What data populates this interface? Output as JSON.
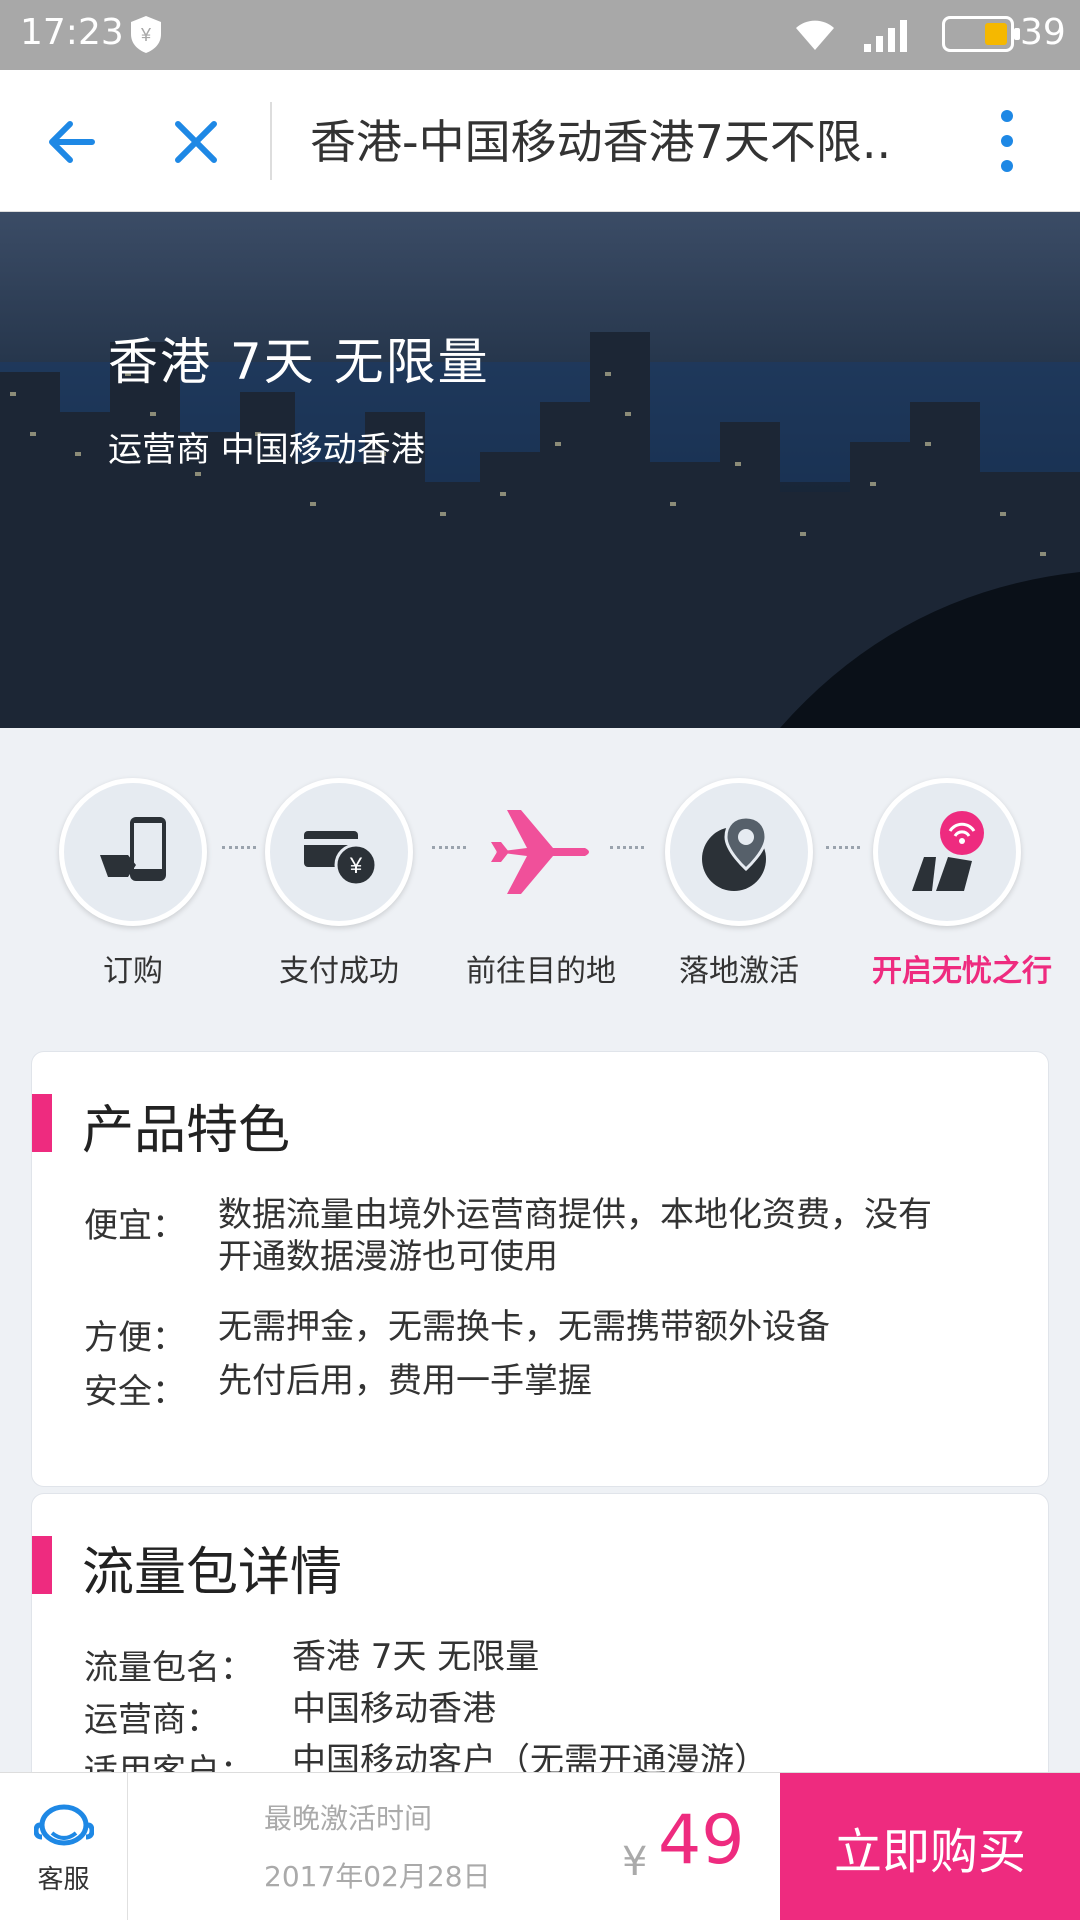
{
  "status_bar": {
    "time": "17:23",
    "battery": "39"
  },
  "nav": {
    "title": "香港-中国移动香港7天不限.."
  },
  "hero": {
    "title": "香港 7天  无限量",
    "subtitle": "运营商 中国移动香港"
  },
  "steps": [
    {
      "label": "订购",
      "icon": "phone-order-icon"
    },
    {
      "label": "支付成功",
      "icon": "payment-icon"
    },
    {
      "label": "前往目的地",
      "icon": "airplane-icon"
    },
    {
      "label": "落地激活",
      "icon": "location-pin-icon"
    },
    {
      "label": "开启无忧之行",
      "icon": "wifi-travel-icon",
      "highlight": true
    }
  ],
  "features": {
    "heading": "产品特色",
    "rows": [
      {
        "key": "便宜：",
        "value_line1": "数据流量由境外运营商提供，本地化资费，没有",
        "value_line2": "开通数据漫游也可使用"
      },
      {
        "key": "方便：",
        "value_line1": "无需押金，无需换卡，无需携带额外设备"
      },
      {
        "key": "安全：",
        "value_line1": "先付后用，费用一手掌握"
      }
    ]
  },
  "package": {
    "heading": "流量包详情",
    "rows": [
      {
        "key": "流量包名：",
        "value": "香港 7天 无限量"
      },
      {
        "key": "运营商：",
        "value": "中国移动香港"
      },
      {
        "key": "适用客户：",
        "value": "中国移动客户（无需开通漫游）"
      }
    ]
  },
  "bottom": {
    "service_label": "客服",
    "deadline_label": "最晚激活时间",
    "deadline_date": "2017年02月28日",
    "currency": "¥",
    "price": "49",
    "buy_label": "立即购买"
  },
  "colors": {
    "accent": "#ee2b7f",
    "nav_icon": "#1e88e5"
  }
}
